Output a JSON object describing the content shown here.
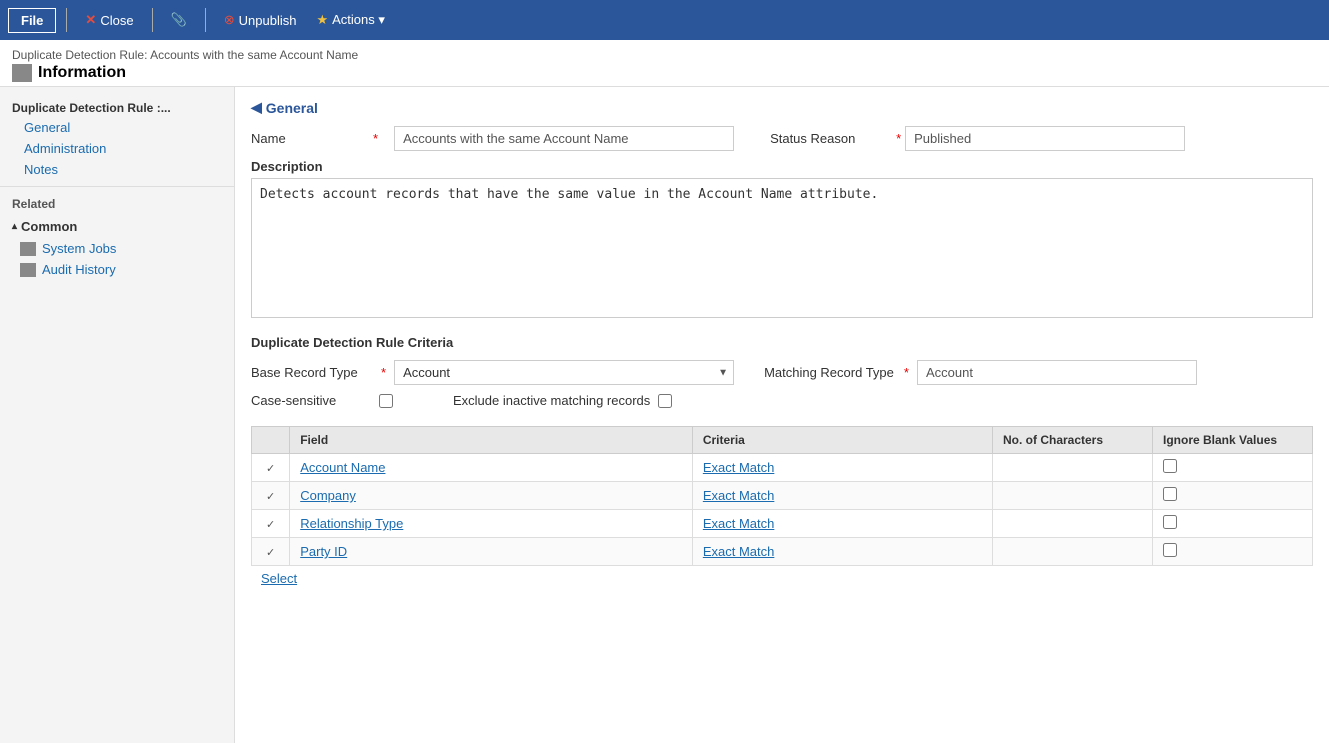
{
  "toolbar": {
    "file_label": "File",
    "close_label": "Close",
    "unpublish_label": "Unpublish",
    "actions_label": "Actions ▾"
  },
  "breadcrumb": {
    "title": "Duplicate Detection Rule: Accounts with the same Account Name",
    "page_title": "Information"
  },
  "sidebar": {
    "section_title": "Duplicate Detection Rule :...",
    "nav_items": [
      {
        "label": "General",
        "id": "general"
      },
      {
        "label": "Administration",
        "id": "administration"
      },
      {
        "label": "Notes",
        "id": "notes"
      }
    ],
    "related_label": "Related",
    "groups": [
      {
        "title": "Common",
        "items": [
          {
            "label": "System Jobs",
            "id": "system-jobs"
          },
          {
            "label": "Audit History",
            "id": "audit-history"
          }
        ]
      }
    ]
  },
  "general": {
    "section_label": "General",
    "name_label": "Name",
    "name_value": "Accounts with the same Account Name",
    "status_reason_label": "Status Reason",
    "status_reason_value": "Published",
    "description_label": "Description",
    "description_value": "Detects account records that have the same value in the Account Name attribute.",
    "criteria_section_label": "Duplicate Detection Rule Criteria",
    "base_record_type_label": "Base Record Type",
    "base_record_type_value": "Account",
    "matching_record_type_label": "Matching Record Type",
    "matching_record_type_value": "Account",
    "case_sensitive_label": "Case-sensitive",
    "exclude_inactive_label": "Exclude inactive matching records",
    "table": {
      "columns": [
        "",
        "Field",
        "Criteria",
        "No. of Characters",
        "Ignore Blank Values"
      ],
      "rows": [
        {
          "field": "Account Name",
          "criteria": "Exact Match",
          "no_chars": "",
          "ignore_blank": false
        },
        {
          "field": "Company",
          "criteria": "Exact Match",
          "no_chars": "",
          "ignore_blank": false
        },
        {
          "field": "Relationship Type",
          "criteria": "Exact Match",
          "no_chars": "",
          "ignore_blank": false
        },
        {
          "field": "Party ID",
          "criteria": "Exact Match",
          "no_chars": "",
          "ignore_blank": false
        }
      ],
      "select_label": "Select"
    }
  }
}
